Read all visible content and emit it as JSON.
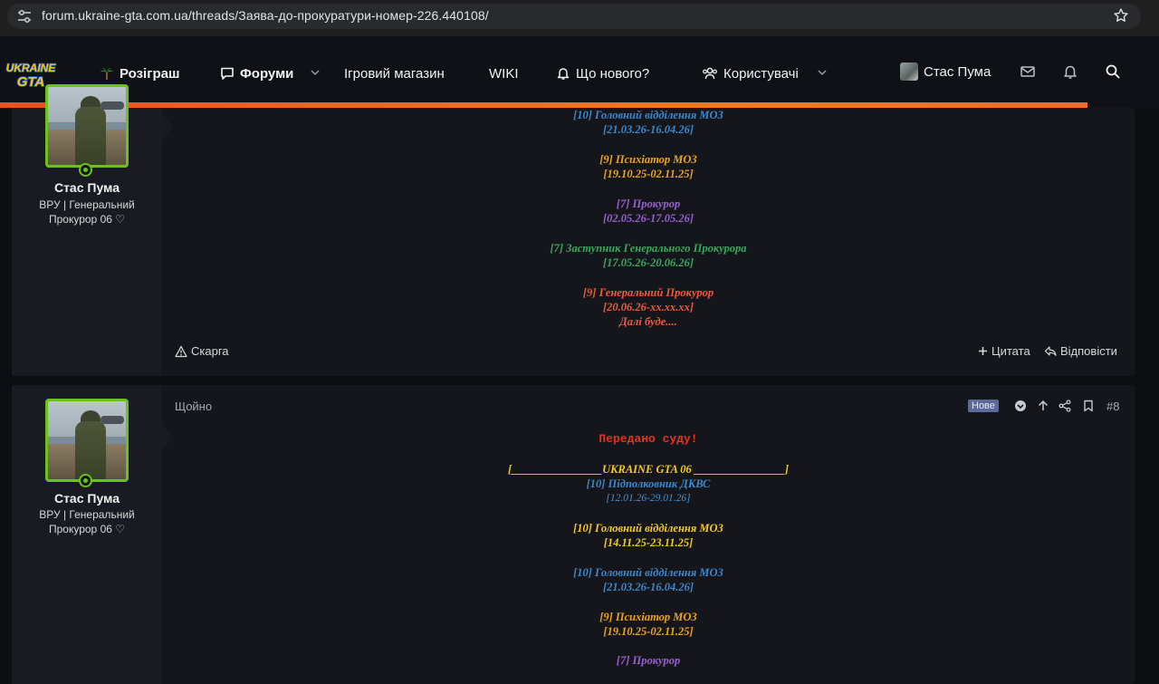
{
  "browser": {
    "url": "forum.ukraine-gta.com.ua/threads/Заява-до-прокуратури-номер-226.440108/"
  },
  "nav": {
    "logo_top": "UKRAINE",
    "logo_bottom": "GTA",
    "items": [
      {
        "label": "Розіграш",
        "icon": "palm-tree-icon"
      },
      {
        "label": "Форуми",
        "icon": "chat-bubble-icon"
      },
      {
        "label": "Ігровий магазин"
      },
      {
        "label": "WIKI"
      },
      {
        "label": "Що нового?",
        "icon": "bell-icon"
      },
      {
        "label": "Користувачі",
        "icon": "users-icon"
      }
    ],
    "user_name": "Стас Пума",
    "accent_color": "#ee6a24"
  },
  "posts": [
    {
      "author": "Стас Пума",
      "title_line1": "ВРУ | Генеральний",
      "title_line2": "Прокурор 06 ♡",
      "lines": [
        {
          "text": "[10] Головний відділення МОЗ",
          "color": "blue"
        },
        {
          "text": "[21.03.26-16.04.26]",
          "color": "blue"
        },
        {
          "text": "",
          "color": "gap"
        },
        {
          "text": "[9] Психіатор МОЗ",
          "color": "orange"
        },
        {
          "text": "[19.10.25-02.11.25]",
          "color": "orange"
        },
        {
          "text": "",
          "color": "gap"
        },
        {
          "text": "[7] Прокурор",
          "color": "purple"
        },
        {
          "text": "[02.05.26-17.05.26]",
          "color": "purple"
        },
        {
          "text": "",
          "color": "gap"
        },
        {
          "text": "[7] Заступник Генерального Прокурора",
          "color": "green"
        },
        {
          "text": "[17.05.26-20.06.26]",
          "color": "green"
        },
        {
          "text": "",
          "color": "gap"
        },
        {
          "text": "[9] Генеральний Прокурор",
          "color": "red"
        },
        {
          "text": "[20.06.26-xx.xx.xx]",
          "color": "red"
        },
        {
          "text": "Далі буде....",
          "color": "red"
        }
      ],
      "report_label": "Скарга",
      "quote_label": "Цитата",
      "reply_label": "Відповісти"
    },
    {
      "author": "Стас Пума",
      "title_line1": "ВРУ | Генеральний",
      "title_line2": "Прокурор 06 ♡",
      "time": "Щойно",
      "badge": "Нове",
      "number": "#8",
      "heading": "Передано суду!",
      "lines": [
        {
          "text": "",
          "color": "gap"
        },
        {
          "text": "[________________UKRAINE GTA 06 ________________]",
          "color": "yellow"
        },
        {
          "text": "[10] Підполковник ДКВС",
          "color": "blue"
        },
        {
          "text": "[12.01.26-29.01.26]",
          "color": "blue-light"
        },
        {
          "text": "",
          "color": "gap"
        },
        {
          "text": "[10] Головний відділення МОЗ",
          "color": "yellow"
        },
        {
          "text": "[14.11.25-23.11.25]",
          "color": "yellow"
        },
        {
          "text": "",
          "color": "gap"
        },
        {
          "text": "[10] Головний відділення МОЗ",
          "color": "blue"
        },
        {
          "text": "[21.03.26-16.04.26]",
          "color": "blue"
        },
        {
          "text": "",
          "color": "gap"
        },
        {
          "text": "[9] Психіатор МОЗ",
          "color": "orange"
        },
        {
          "text": "[19.10.25-02.11.25]",
          "color": "orange"
        },
        {
          "text": "",
          "color": "gap"
        },
        {
          "text": "[7] Прокурор",
          "color": "purple"
        }
      ]
    }
  ]
}
